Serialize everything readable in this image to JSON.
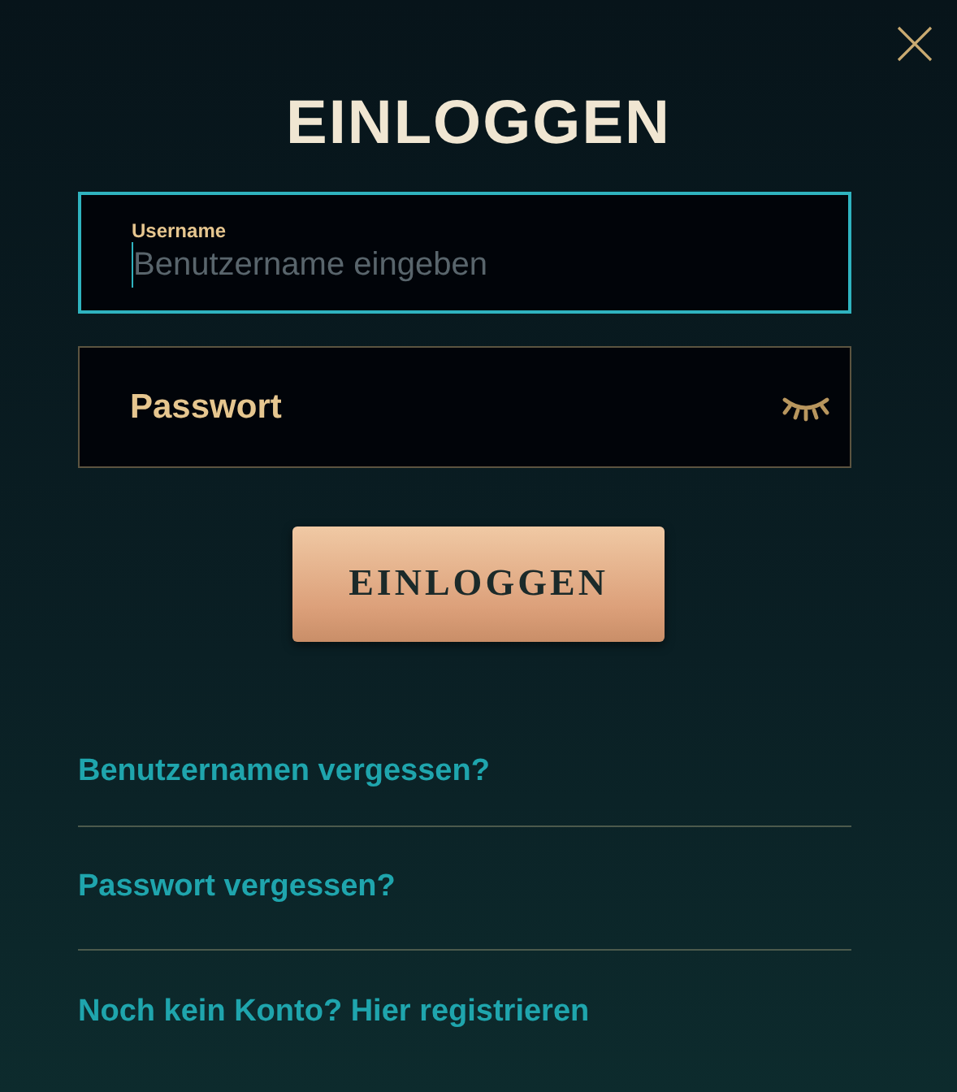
{
  "title": "EINLOGGEN",
  "fields": [
    {
      "kind": "text",
      "label": "Username",
      "placeholder": "Benutzername eingeben",
      "focused": true
    },
    {
      "kind": "password",
      "placeholder": "Passwort",
      "focused": false
    }
  ],
  "submit": "EINLOGGEN",
  "links": [
    "Benutzernamen vergessen?",
    "Passwort vergessen?",
    "Noch kein Konto? Hier registrieren"
  ]
}
